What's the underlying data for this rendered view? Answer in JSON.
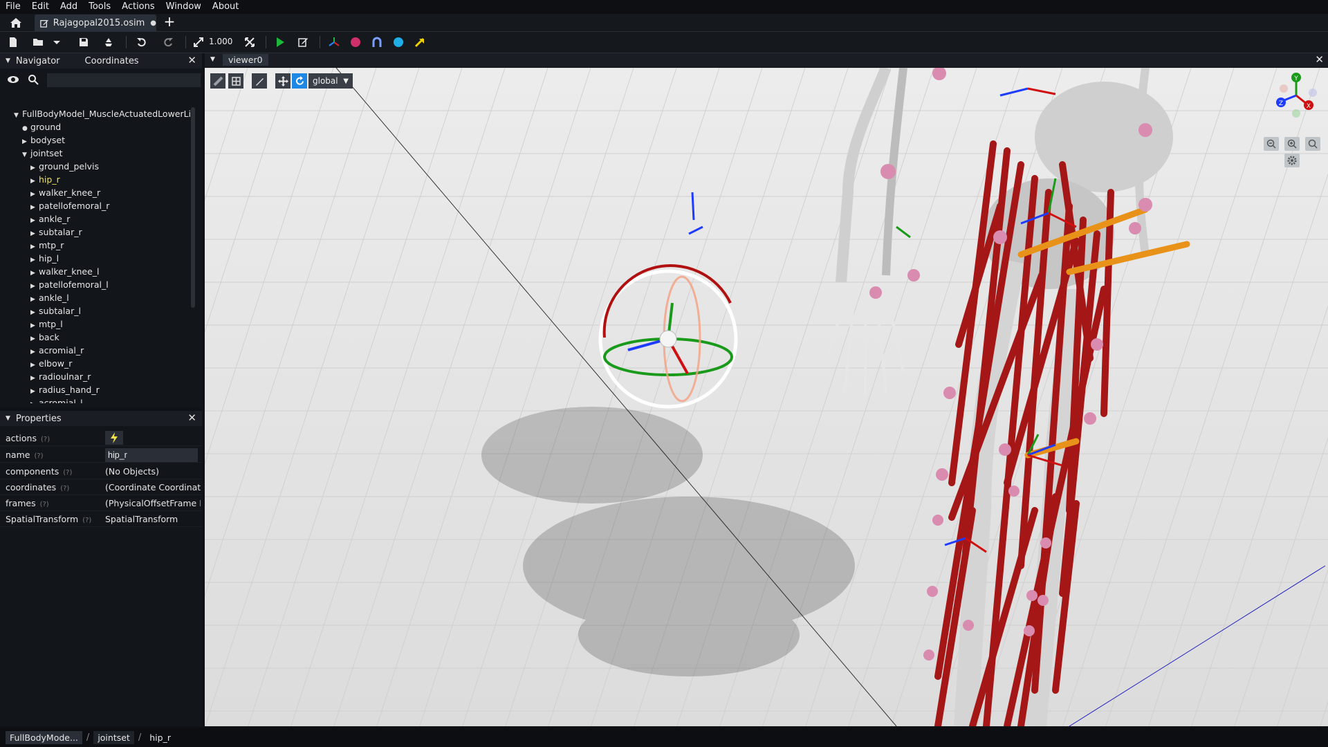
{
  "menu": [
    "File",
    "Edit",
    "Add",
    "Tools",
    "Actions",
    "Window",
    "About"
  ],
  "tab": {
    "title": "Rajagopal2015.osim",
    "modified_dot": "●",
    "add": "+"
  },
  "toolbar": {
    "scale_value": "1.000"
  },
  "navigator": {
    "title": "Navigator",
    "coordinates_tab": "Coordinates",
    "search_placeholder": "",
    "tree": [
      {
        "label": "FullBodyModel_MuscleActuatedLowerLim",
        "depth": 0,
        "arrow": "▼"
      },
      {
        "label": "ground",
        "depth": 1,
        "arrow": "●"
      },
      {
        "label": "bodyset",
        "depth": 1,
        "arrow": "▶"
      },
      {
        "label": "jointset",
        "depth": 1,
        "arrow": "▼"
      },
      {
        "label": "ground_pelvis",
        "depth": 2,
        "arrow": "▶"
      },
      {
        "label": "hip_r",
        "depth": 2,
        "arrow": "▶",
        "selected": true
      },
      {
        "label": "walker_knee_r",
        "depth": 2,
        "arrow": "▶"
      },
      {
        "label": "patellofemoral_r",
        "depth": 2,
        "arrow": "▶"
      },
      {
        "label": "ankle_r",
        "depth": 2,
        "arrow": "▶"
      },
      {
        "label": "subtalar_r",
        "depth": 2,
        "arrow": "▶"
      },
      {
        "label": "mtp_r",
        "depth": 2,
        "arrow": "▶"
      },
      {
        "label": "hip_l",
        "depth": 2,
        "arrow": "▶"
      },
      {
        "label": "walker_knee_l",
        "depth": 2,
        "arrow": "▶"
      },
      {
        "label": "patellofemoral_l",
        "depth": 2,
        "arrow": "▶"
      },
      {
        "label": "ankle_l",
        "depth": 2,
        "arrow": "▶"
      },
      {
        "label": "subtalar_l",
        "depth": 2,
        "arrow": "▶"
      },
      {
        "label": "mtp_l",
        "depth": 2,
        "arrow": "▶"
      },
      {
        "label": "back",
        "depth": 2,
        "arrow": "▶"
      },
      {
        "label": "acromial_r",
        "depth": 2,
        "arrow": "▶"
      },
      {
        "label": "elbow_r",
        "depth": 2,
        "arrow": "▶"
      },
      {
        "label": "radioulnar_r",
        "depth": 2,
        "arrow": "▶"
      },
      {
        "label": "radius_hand_r",
        "depth": 2,
        "arrow": "▶"
      },
      {
        "label": "acromial_l",
        "depth": 2,
        "arrow": "▶"
      }
    ]
  },
  "properties": {
    "title": "Properties",
    "help": "(?)",
    "rows": [
      {
        "key": "actions",
        "value": ""
      },
      {
        "key": "name",
        "value": "hip_r"
      },
      {
        "key": "components",
        "value": "(No Objects)"
      },
      {
        "key": "coordinates",
        "value": "(Coordinate Coordinate"
      },
      {
        "key": "frames",
        "value": "(PhysicalOffsetFrame Pl"
      },
      {
        "key": "SpatialTransform",
        "value": "SpatialTransform"
      }
    ]
  },
  "viewer": {
    "tab_title": "viewer0",
    "frame_mode": "global",
    "axis_labels": {
      "x": "X",
      "y": "Y",
      "z": "Z"
    }
  },
  "breadcrumb": [
    "FullBodyMode...",
    "jointset",
    "hip_r"
  ],
  "colors": {
    "selected_text": "#f4e24b",
    "muscle": "#a51717",
    "marker": "#d98cb0",
    "accent_blue": "#1e88e5"
  }
}
